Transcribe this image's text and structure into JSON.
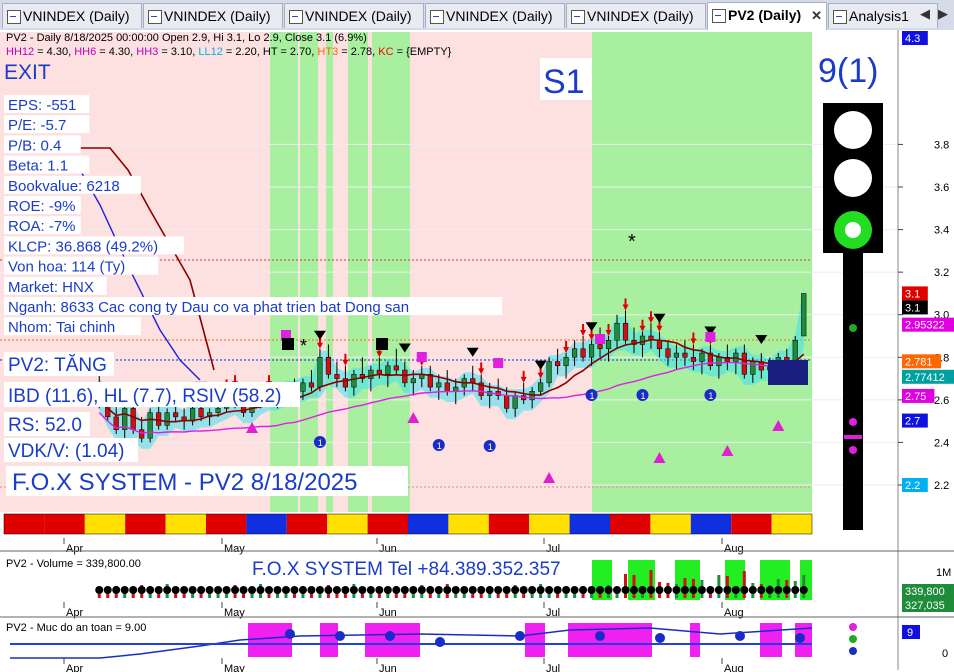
{
  "tabs": [
    {
      "label": "VNINDEX (Daily)",
      "active": false
    },
    {
      "label": "VNINDEX (Daily)",
      "active": false
    },
    {
      "label": "VNINDEX (Daily)",
      "active": false
    },
    {
      "label": "VNINDEX (Daily)",
      "active": false
    },
    {
      "label": "VNINDEX (Daily)",
      "active": false
    },
    {
      "label": "PV2 (Daily)",
      "active": true
    },
    {
      "label": "Analysis1",
      "active": false
    }
  ],
  "header": {
    "line1": "PV2 - Daily 8/18/2025 00:00:00 Open 2.9, Hi 3.1, Lo 2.9, Close 3.1 (6.9%)",
    "line2": [
      {
        "text": "HH12",
        "color": "#c000c0"
      },
      {
        "text": " = 4.30, ",
        "color": "#000000"
      },
      {
        "text": "HH6",
        "color": "#c000c0"
      },
      {
        "text": " = 4.30, ",
        "color": "#000000"
      },
      {
        "text": "HH3",
        "color": "#c000c0"
      },
      {
        "text": " = 3.10, ",
        "color": "#000000"
      },
      {
        "text": "LL12",
        "color": "#00b0f0"
      },
      {
        "text": " = 2.20, ",
        "color": "#000000"
      },
      {
        "text": "HT",
        "color": "#000000"
      },
      {
        "text": " = 2.70, ",
        "color": "#000000"
      },
      {
        "text": "HT3",
        "color": "#ff6600"
      },
      {
        "text": " = 2.78, ",
        "color": "#000000"
      },
      {
        "text": "KC",
        "color": "#ff0000"
      },
      {
        "text": " = {EMPTY}",
        "color": "#000000"
      }
    ]
  },
  "overlay": {
    "exit": "EXIT",
    "fundamentals": [
      "EPS: -551",
      "P/E: -5.7",
      "P/B: 0.4",
      "Beta: 1.1",
      "Bookvalue: 6218",
      "ROE: -9%",
      "ROA: -7%",
      "KLCP: 36.868 (49.2%)",
      "Von hoa: 114 (Ty)",
      "Market: HNX",
      "Nganh: 8633 Cac cong ty Dau co va phat trien bat Dong san",
      "Nhom: Tai chinh"
    ],
    "pv2": "PV2: TĂNG",
    "ibd": "IBD (11.6), HL (7.7), RSIV (58.2)",
    "rs": "RS: 52.0",
    "vdk": "VDK/V:  (1.04)",
    "system": "F.O.X SYSTEM - PV2 8/18/2025",
    "stage": "S1",
    "count": "9(1)",
    "tel": "F.O.X SYSTEM Tel +84.389.352.357"
  },
  "colors": {
    "up": "#1e8c3a",
    "down": "#d01010",
    "green_zone": "#a8f0a0",
    "pink_zone": "#fde0e0",
    "ma": "#8b0000",
    "cloud": "#40e0f0",
    "dotted_blue": "#2020e0",
    "label_blue": "#1a3cc8"
  },
  "chart_data": [
    {
      "type": "candlestick",
      "title": "PV2 - Daily",
      "x_months": [
        "Apr",
        "May",
        "Jun",
        "Jul",
        "Aug"
      ],
      "y_ticks": [
        2.2,
        2.4,
        2.6,
        2.8,
        3.0,
        3.2,
        3.4,
        3.6,
        3.8
      ],
      "ylim": [
        2.2,
        4.3
      ],
      "price_tags": [
        {
          "value": 4.3,
          "label": "4.3",
          "color": "#1010e0"
        },
        {
          "value": 3.1,
          "label": "3.1",
          "color": "#e00000"
        },
        {
          "value": 3.1,
          "label": "3.1",
          "color": "#000000"
        },
        {
          "value": 2.95322,
          "label": "2.95322",
          "color": "#e000e0"
        },
        {
          "value": 2.781,
          "label": "2.781",
          "color": "#ff6600"
        },
        {
          "value": 2.77412,
          "label": "2.77412",
          "color": "#00a0a0"
        },
        {
          "value": 2.75,
          "label": "2.75",
          "color": "#e000e0"
        },
        {
          "value": 2.7,
          "label": "2.7",
          "color": "#1010e0"
        },
        {
          "value": 2.2,
          "label": "2.2",
          "color": "#00b0f0"
        }
      ],
      "ohlc": [
        [
          2.68,
          2.72,
          2.56,
          2.6
        ],
        [
          2.6,
          2.64,
          2.5,
          2.52
        ],
        [
          2.52,
          2.58,
          2.44,
          2.46
        ],
        [
          2.46,
          2.58,
          2.42,
          2.56
        ],
        [
          2.56,
          2.6,
          2.44,
          2.46
        ],
        [
          2.46,
          2.52,
          2.4,
          2.42
        ],
        [
          2.42,
          2.56,
          2.4,
          2.54
        ],
        [
          2.54,
          2.58,
          2.46,
          2.48
        ],
        [
          2.48,
          2.56,
          2.46,
          2.54
        ],
        [
          2.54,
          2.6,
          2.5,
          2.52
        ],
        [
          2.52,
          2.56,
          2.46,
          2.5
        ],
        [
          2.5,
          2.58,
          2.48,
          2.56
        ],
        [
          2.56,
          2.6,
          2.5,
          2.52
        ],
        [
          2.52,
          2.56,
          2.48,
          2.54
        ],
        [
          2.54,
          2.6,
          2.52,
          2.56
        ],
        [
          2.56,
          2.64,
          2.54,
          2.6
        ],
        [
          2.6,
          2.66,
          2.56,
          2.58
        ],
        [
          2.58,
          2.62,
          2.52,
          2.54
        ],
        [
          2.54,
          2.6,
          2.52,
          2.58
        ],
        [
          2.58,
          2.64,
          2.56,
          2.62
        ],
        [
          2.62,
          2.66,
          2.58,
          2.6
        ],
        [
          2.6,
          2.64,
          2.56,
          2.62
        ],
        [
          2.62,
          2.68,
          2.6,
          2.66
        ],
        [
          2.66,
          2.7,
          2.62,
          2.64
        ],
        [
          2.64,
          2.7,
          2.6,
          2.68
        ],
        [
          2.68,
          2.74,
          2.64,
          2.66
        ],
        [
          2.66,
          2.84,
          2.64,
          2.8
        ],
        [
          2.8,
          2.86,
          2.7,
          2.72
        ],
        [
          2.72,
          2.78,
          2.66,
          2.7
        ],
        [
          2.7,
          2.76,
          2.64,
          2.66
        ],
        [
          2.66,
          2.74,
          2.62,
          2.72
        ],
        [
          2.72,
          2.8,
          2.68,
          2.7
        ],
        [
          2.7,
          2.76,
          2.64,
          2.74
        ],
        [
          2.74,
          2.8,
          2.7,
          2.72
        ],
        [
          2.72,
          2.78,
          2.66,
          2.76
        ],
        [
          2.76,
          2.84,
          2.72,
          2.74
        ],
        [
          2.74,
          2.78,
          2.66,
          2.68
        ],
        [
          2.68,
          2.74,
          2.62,
          2.7
        ],
        [
          2.7,
          2.76,
          2.66,
          2.72
        ],
        [
          2.72,
          2.76,
          2.64,
          2.66
        ],
        [
          2.66,
          2.72,
          2.6,
          2.68
        ],
        [
          2.68,
          2.74,
          2.62,
          2.64
        ],
        [
          2.64,
          2.7,
          2.58,
          2.66
        ],
        [
          2.66,
          2.72,
          2.62,
          2.7
        ],
        [
          2.7,
          2.76,
          2.64,
          2.68
        ],
        [
          2.68,
          2.72,
          2.6,
          2.62
        ],
        [
          2.62,
          2.68,
          2.56,
          2.64
        ],
        [
          2.64,
          2.7,
          2.6,
          2.62
        ],
        [
          2.62,
          2.66,
          2.54,
          2.56
        ],
        [
          2.56,
          2.64,
          2.52,
          2.62
        ],
        [
          2.62,
          2.68,
          2.58,
          2.6
        ],
        [
          2.6,
          2.66,
          2.56,
          2.64
        ],
        [
          2.64,
          2.7,
          2.62,
          2.68
        ],
        [
          2.68,
          2.8,
          2.66,
          2.78
        ],
        [
          2.78,
          2.84,
          2.72,
          2.76
        ],
        [
          2.76,
          2.82,
          2.7,
          2.8
        ],
        [
          2.8,
          2.88,
          2.76,
          2.84
        ],
        [
          2.84,
          2.9,
          2.78,
          2.8
        ],
        [
          2.8,
          2.88,
          2.76,
          2.86
        ],
        [
          2.86,
          2.94,
          2.8,
          2.84
        ],
        [
          2.84,
          2.9,
          2.78,
          2.88
        ],
        [
          2.88,
          3.0,
          2.84,
          2.96
        ],
        [
          2.96,
          3.02,
          2.86,
          2.88
        ],
        [
          2.88,
          2.94,
          2.82,
          2.86
        ],
        [
          2.86,
          2.92,
          2.8,
          2.9
        ],
        [
          2.9,
          2.96,
          2.84,
          2.88
        ],
        [
          2.88,
          2.92,
          2.8,
          2.84
        ],
        [
          2.84,
          2.88,
          2.76,
          2.8
        ],
        [
          2.8,
          2.86,
          2.74,
          2.82
        ],
        [
          2.82,
          2.88,
          2.76,
          2.8
        ],
        [
          2.8,
          2.86,
          2.74,
          2.78
        ],
        [
          2.78,
          2.84,
          2.72,
          2.82
        ],
        [
          2.82,
          2.86,
          2.74,
          2.76
        ],
        [
          2.76,
          2.82,
          2.7,
          2.8
        ],
        [
          2.8,
          2.86,
          2.74,
          2.78
        ],
        [
          2.78,
          2.84,
          2.72,
          2.82
        ],
        [
          2.82,
          2.86,
          2.7,
          2.72
        ],
        [
          2.72,
          2.8,
          2.68,
          2.78
        ],
        [
          2.78,
          2.82,
          2.7,
          2.74
        ],
        [
          2.74,
          2.8,
          2.7,
          2.76
        ],
        [
          2.76,
          2.82,
          2.72,
          2.8
        ],
        [
          2.8,
          2.84,
          2.72,
          2.74
        ],
        [
          2.74,
          2.9,
          2.72,
          2.88
        ],
        [
          2.9,
          3.1,
          2.9,
          3.1
        ]
      ]
    },
    {
      "type": "bar",
      "title": "PV2 - Volume = 339,800.00",
      "x_months": [
        "Apr",
        "May",
        "Jun",
        "Jul",
        "Aug"
      ],
      "y_ticks": [
        {
          "value": 1000000,
          "label": "1M"
        }
      ],
      "price_tags": [
        {
          "value": 339800,
          "label": "339,800",
          "color": "#1e8c3a"
        },
        {
          "value": 327035,
          "label": "327,035",
          "color": "#1e8c3a"
        }
      ]
    },
    {
      "type": "line",
      "title": "PV2 - Muc do an toan = 9.00",
      "x_months": [
        "Apr",
        "May",
        "Jun",
        "Jul",
        "Aug"
      ],
      "y_ticks": [
        {
          "value": 0,
          "label": "0"
        }
      ],
      "price_tags": [
        {
          "value": 9,
          "label": "9",
          "color": "#1010e0"
        }
      ]
    }
  ]
}
